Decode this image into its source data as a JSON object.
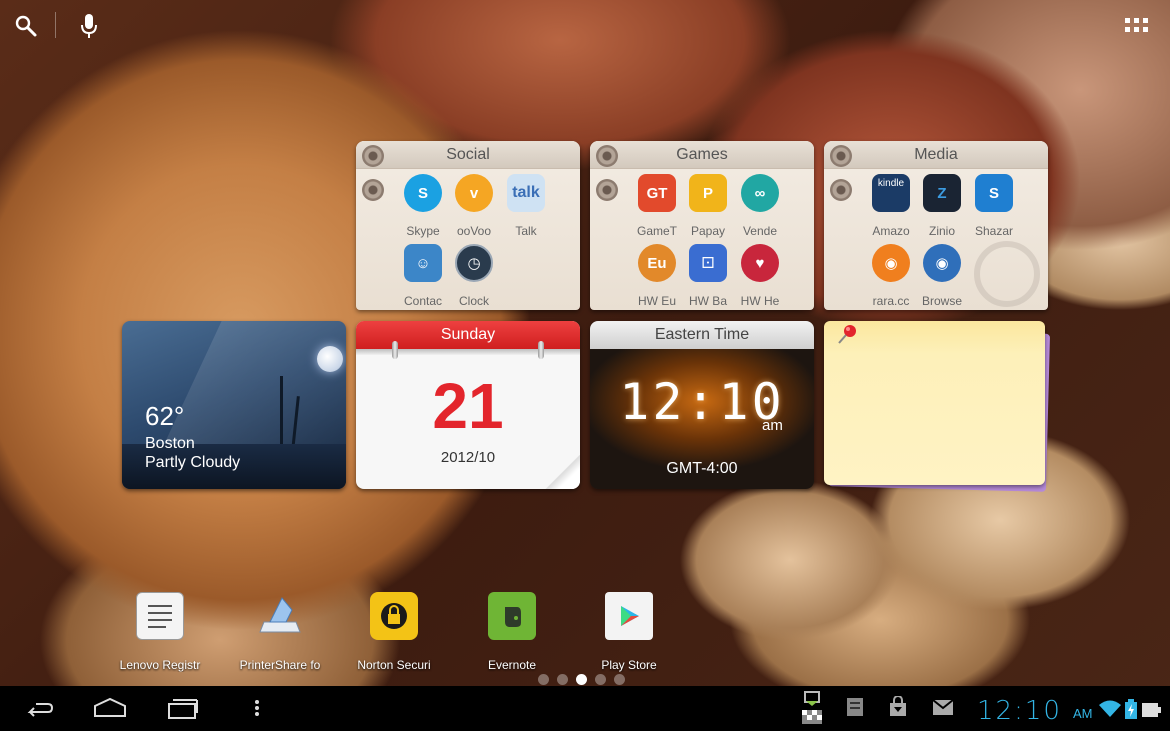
{
  "top_bar": {
    "icons": [
      "search-icon",
      "mic-icon",
      "all-apps-icon"
    ]
  },
  "folders": [
    {
      "title": "Social",
      "apps": [
        {
          "label": "Skype",
          "icon": "skype-icon",
          "color": "#1ba1e2"
        },
        {
          "label": "ooVoo",
          "icon": "oovoo-icon",
          "color": "#f5a623"
        },
        {
          "label": "Talk",
          "icon": "talk-icon",
          "color": "#7ab0e0"
        },
        {
          "label": "Contac",
          "icon": "contacts-icon",
          "color": "#3c86c8"
        },
        {
          "label": "Clock",
          "icon": "clock-icon",
          "color": "#2a3b4d"
        }
      ]
    },
    {
      "title": "Games",
      "apps": [
        {
          "label": "GameT",
          "icon": "gametown-icon",
          "color": "#e24a2c"
        },
        {
          "label": "Papay",
          "icon": "papaya-icon",
          "color": "#f1b41a"
        },
        {
          "label": "Vende",
          "icon": "vendetta-icon",
          "color": "#21a7a3"
        },
        {
          "label": "HW Eu",
          "icon": "hw-eu-icon",
          "color": "#e2892a"
        },
        {
          "label": "HW Ba",
          "icon": "hw-ba-icon",
          "color": "#3a6dd1"
        },
        {
          "label": "HW He",
          "icon": "hw-he-icon",
          "color": "#c8263c"
        }
      ]
    },
    {
      "title": "Media",
      "apps": [
        {
          "label": "Amazo",
          "icon": "kindle-icon",
          "color": "#1b3b66",
          "text": "kindle"
        },
        {
          "label": "Zinio",
          "icon": "zinio-icon",
          "color": "#1a2433"
        },
        {
          "label": "Shazar",
          "icon": "shazam-icon",
          "color": "#1f7fd1"
        },
        {
          "label": "rara.cc",
          "icon": "rara-icon",
          "color": "#f07f1e"
        },
        {
          "label": "Browse",
          "icon": "browser-icon",
          "color": "#2f6fba"
        }
      ]
    }
  ],
  "weather": {
    "temperature": "62°",
    "city": "Boston",
    "condition": "Partly Cloudy"
  },
  "calendar": {
    "weekday": "Sunday",
    "day": "21",
    "date": "2012/10"
  },
  "world_clock": {
    "title": "Eastern Time",
    "time": "12:10",
    "ampm": "am",
    "timezone": "GMT-4:00"
  },
  "dock": [
    {
      "label": "Lenovo Registr",
      "icon": "lenovo-registration-icon"
    },
    {
      "label": "PrinterShare fo",
      "icon": "printershare-icon"
    },
    {
      "label": "Norton Securi",
      "icon": "norton-icon"
    },
    {
      "label": "Evernote",
      "icon": "evernote-icon"
    },
    {
      "label": "Play Store",
      "icon": "play-store-icon"
    }
  ],
  "page_indicator": {
    "count": 5,
    "active_index": 2
  },
  "system_bar": {
    "time": "12:10",
    "ampm": "AM",
    "accent_color": "#33b5e5"
  }
}
